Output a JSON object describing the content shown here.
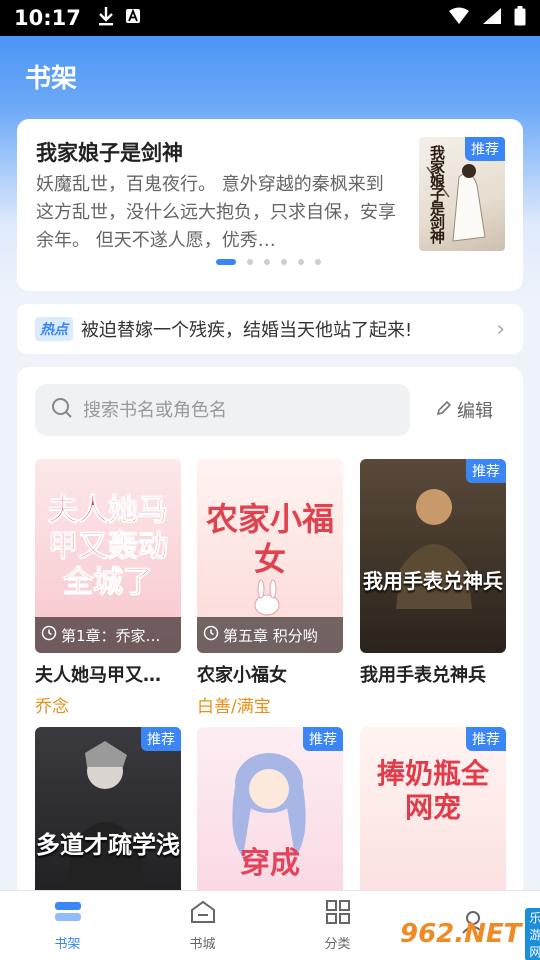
{
  "status_bar": {
    "time": "10:17"
  },
  "header": {
    "title": "书架"
  },
  "featured": {
    "title": "我家娘子是剑神",
    "description": "妖魔乱世，百鬼夜行。 意外穿越的秦枫来到这方乱世，没什么远大抱负，只求自保，安享余年。 但天不遂人愿，优秀…",
    "tag": "推荐",
    "cover_text": "我家娘子是剑神",
    "carousel_total": 6,
    "carousel_active": 0
  },
  "hot": {
    "badge": "热点",
    "text": "被迫替嫁一个残疾，结婚当天他站了起来!"
  },
  "search": {
    "placeholder": "搜索书名或角色名",
    "edit_label": "编辑"
  },
  "books": [
    {
      "title": "夫人她马甲又…",
      "author": "乔念",
      "progress": "第1章：乔家…",
      "tag": "",
      "cover_text": "夫人她马甲又轰动全城了",
      "cover_color": "#fbd9dc"
    },
    {
      "title": "农家小福女",
      "author": "白善/满宝",
      "progress": "第五章 积分哟",
      "tag": "",
      "cover_text": "农家小福女",
      "cover_color": "#fbe6e4"
    },
    {
      "title": "我用手表兑神兵",
      "author": "",
      "progress": "",
      "tag": "推荐",
      "cover_text": "我用手表兑神兵",
      "cover_color": "#3a2f26"
    },
    {
      "title": "",
      "author": "",
      "progress": "",
      "tag": "推荐",
      "cover_text": "多道才疏学浅",
      "cover_color": "#2a2a2c"
    },
    {
      "title": "",
      "author": "",
      "progress": "",
      "tag": "推荐",
      "cover_text": "穿成",
      "cover_color": "#fde7ef"
    },
    {
      "title": "",
      "author": "",
      "progress": "",
      "tag": "推荐",
      "cover_text": "捧奶瓶全网宠",
      "cover_color": "#fbe3e3"
    }
  ],
  "nav": {
    "items": [
      {
        "label": "书架",
        "icon": "bookshelf-icon",
        "active": true
      },
      {
        "label": "书城",
        "icon": "bookstore-icon",
        "active": false
      },
      {
        "label": "分类",
        "icon": "category-icon",
        "active": false
      },
      {
        "label": "",
        "icon": "profile-icon",
        "active": false
      }
    ]
  },
  "watermark": {
    "logo": "962.NET",
    "sub": "乐游网"
  },
  "colors": {
    "accent": "#3b86f6",
    "author": "#e8901a"
  }
}
